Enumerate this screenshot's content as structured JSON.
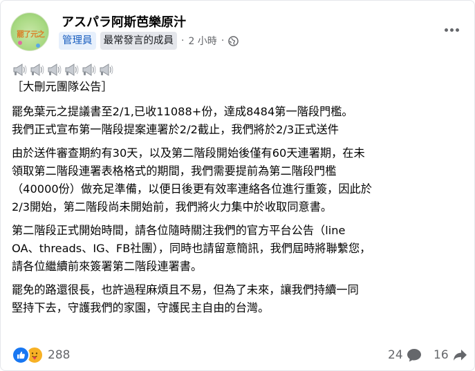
{
  "post": {
    "group_name": "アスパラ阿斯芭樂原汁",
    "avatar_text": "罷了元之",
    "badges": {
      "admin": "管理員",
      "top_contributor": "最常發言的成員"
    },
    "separator": "·",
    "time": "2 小時",
    "audience_icon": "globe-icon",
    "menu_icon": "more-horizontal-icon",
    "emoji_icon": "megaphone-icon",
    "emoji_count": 6,
    "announcement": "［大刪元團隊公告］",
    "paragraphs": [
      [
        "罷免葉元之提議書至2/1,已收11088+份，達成8484第一階段門檻。",
        "我們正式宣布第一階段提案連署於2/2截止，我們將於2/3正式送件"
      ],
      [
        "由於送件審查期約有30天，以及第二階段開始後僅有60天連署期，在未",
        "領取第二階段連署表格格式的期間，我們需要提前為第二階段門檻",
        "（40000份）做充足準備，以便日後更有效率連絡各位進行重簽，因此於",
        "2/3開始，第二階段尚未開始前，我們將火力集中於收取同意書。"
      ],
      [
        "第二階段正式開始時間，請各位隨時關注我們的官方平台公告（line",
        "OA、threads、IG、FB社團），同時也請留意簡訊，我們屆時將聯繫您，",
        "請各位繼續前來簽署第二階段連署書。"
      ],
      [
        "罷免的路還很長，也許過程麻煩且不易，但為了未來，讓我們持續一同",
        "堅持下去，守護我們的家園，守護民主自由的台灣。"
      ]
    ]
  },
  "footer": {
    "reaction_icons": [
      "like-icon",
      "care-icon"
    ],
    "reaction_count": "288",
    "comment_count": "24",
    "share_count": "16"
  },
  "colors": {
    "accent": "#1877f2",
    "admin_badge_text": "#1b5fbf",
    "admin_badge_bg": "#e7f0fc",
    "muted": "#65676b"
  }
}
